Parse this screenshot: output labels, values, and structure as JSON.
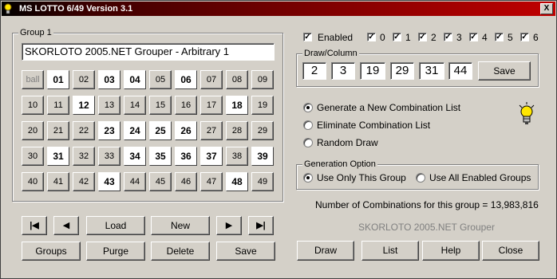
{
  "window": {
    "title": "MS LOTTO 6/49 Version 3.1",
    "close_glyph": "X",
    "app_icon": "lightbulb-icon"
  },
  "group": {
    "legend": "Group 1",
    "name_value": "SKORLOTO 2005.NET Grouper - Arbitrary 1",
    "cells": [
      {
        "label": "ball",
        "selected": false,
        "dim": true
      },
      {
        "label": "01",
        "selected": true
      },
      {
        "label": "02",
        "selected": false
      },
      {
        "label": "03",
        "selected": true
      },
      {
        "label": "04",
        "selected": true
      },
      {
        "label": "05",
        "selected": false
      },
      {
        "label": "06",
        "selected": true
      },
      {
        "label": "07",
        "selected": false
      },
      {
        "label": "08",
        "selected": false
      },
      {
        "label": "09",
        "selected": false
      },
      {
        "label": "10",
        "selected": false
      },
      {
        "label": "11",
        "selected": false
      },
      {
        "label": "12",
        "selected": true
      },
      {
        "label": "13",
        "selected": false
      },
      {
        "label": "14",
        "selected": false
      },
      {
        "label": "15",
        "selected": false
      },
      {
        "label": "16",
        "selected": false
      },
      {
        "label": "17",
        "selected": false
      },
      {
        "label": "18",
        "selected": true
      },
      {
        "label": "19",
        "selected": false
      },
      {
        "label": "20",
        "selected": false
      },
      {
        "label": "21",
        "selected": false
      },
      {
        "label": "22",
        "selected": false
      },
      {
        "label": "23",
        "selected": true
      },
      {
        "label": "24",
        "selected": true
      },
      {
        "label": "25",
        "selected": true
      },
      {
        "label": "26",
        "selected": true
      },
      {
        "label": "27",
        "selected": false
      },
      {
        "label": "28",
        "selected": false
      },
      {
        "label": "29",
        "selected": false
      },
      {
        "label": "30",
        "selected": false
      },
      {
        "label": "31",
        "selected": true
      },
      {
        "label": "32",
        "selected": false
      },
      {
        "label": "33",
        "selected": false
      },
      {
        "label": "34",
        "selected": true
      },
      {
        "label": "35",
        "selected": true
      },
      {
        "label": "36",
        "selected": true
      },
      {
        "label": "37",
        "selected": true
      },
      {
        "label": "38",
        "selected": false
      },
      {
        "label": "39",
        "selected": true
      },
      {
        "label": "40",
        "selected": false
      },
      {
        "label": "41",
        "selected": false
      },
      {
        "label": "42",
        "selected": false
      },
      {
        "label": "43",
        "selected": true
      },
      {
        "label": "44",
        "selected": false
      },
      {
        "label": "45",
        "selected": false
      },
      {
        "label": "46",
        "selected": false
      },
      {
        "label": "47",
        "selected": false
      },
      {
        "label": "48",
        "selected": true
      },
      {
        "label": "49",
        "selected": false
      }
    ]
  },
  "nav": {
    "first": "|◀",
    "prev": "◀",
    "load": "Load",
    "new": "New",
    "next": "▶",
    "last": "▶|",
    "groups": "Groups",
    "purge": "Purge",
    "delete": "Delete",
    "save": "Save"
  },
  "enabled": {
    "label": "Enabled",
    "checked": true
  },
  "digit_checks": [
    {
      "label": "0",
      "checked": true
    },
    {
      "label": "1",
      "checked": true
    },
    {
      "label": "2",
      "checked": true
    },
    {
      "label": "3",
      "checked": true
    },
    {
      "label": "4",
      "checked": true
    },
    {
      "label": "5",
      "checked": true
    },
    {
      "label": "6",
      "checked": true
    }
  ],
  "draw": {
    "legend": "Draw/Column",
    "numbers": [
      "2",
      "3",
      "19",
      "29",
      "31",
      "44"
    ],
    "save_label": "Save"
  },
  "mode_options": [
    {
      "label": "Generate a New Combination List",
      "selected": true
    },
    {
      "label": "Eliminate Combination List",
      "selected": false
    },
    {
      "label": "Random Draw",
      "selected": false
    }
  ],
  "generation": {
    "legend": "Generation Option",
    "options": [
      {
        "label": "Use Only This Group",
        "selected": true
      },
      {
        "label": "Use All Enabled Groups",
        "selected": false
      }
    ]
  },
  "status": {
    "combinations_text": "Number of  Combinations for this group =  13,983,816"
  },
  "watermark": "SKORLOTO 2005.NET Grouper",
  "actions": {
    "draw": "Draw",
    "list": "List",
    "help": "Help",
    "close": "Close"
  },
  "colors": {
    "title_start": "#000000",
    "title_end": "#c00000",
    "face": "#d4d0c8",
    "bulb": "#ffe600"
  }
}
